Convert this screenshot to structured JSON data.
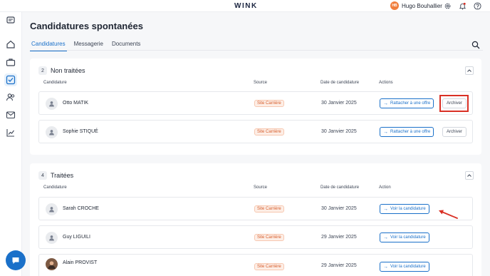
{
  "app": {
    "logo": "WINK"
  },
  "user": {
    "initials": "HB",
    "name": "Hugo Bouhallier"
  },
  "page": {
    "title": "Candidatures spontanées"
  },
  "tabs": [
    {
      "label": "Candidatures",
      "active": true
    },
    {
      "label": "Messagerie",
      "active": false
    },
    {
      "label": "Documents",
      "active": false
    }
  ],
  "sections": {
    "non_traitees": {
      "count": "2",
      "title": "Non traitées",
      "columns": {
        "candidate": "Candidature",
        "source": "Source",
        "date": "Date de candidature",
        "actions": "Actions"
      },
      "rows": [
        {
          "name": "Otto MATIK",
          "source": "Site Carrière",
          "date": "30 Janvier 2025",
          "primary_action": "Rattacher à une offre",
          "secondary_action": "Archiver"
        },
        {
          "name": "Sophie STIQUÉ",
          "source": "Site Carrière",
          "date": "30 Janvier 2025",
          "primary_action": "Rattacher à une offre",
          "secondary_action": "Archiver"
        }
      ]
    },
    "traitees": {
      "count": "4",
      "title": "Traitées",
      "columns": {
        "candidate": "Candidature",
        "source": "Source",
        "date": "Date de candidature",
        "action": "Action"
      },
      "rows": [
        {
          "name": "Sarah CROCHE",
          "source": "Site Carrière",
          "date": "30 Janvier 2025",
          "action": "Voir la candidature"
        },
        {
          "name": "Guy LIGUILI",
          "source": "Site Carrière",
          "date": "29 Janvier 2025",
          "action": "Voir la candidature"
        },
        {
          "name": "Alain PROVIST",
          "source": "Site Carrière",
          "date": "29 Janvier 2025",
          "action": "Voir la candidature"
        }
      ]
    }
  },
  "icons": {
    "top": [
      "gear-icon",
      "bell-icon",
      "help-icon"
    ],
    "sidebar": [
      "company-icon",
      "home-icon",
      "briefcase-icon",
      "applications-icon",
      "users-icon",
      "mail-icon",
      "chart-icon"
    ],
    "other": [
      "search-icon",
      "chevron-up-icon",
      "arrow-right-icon",
      "chat-icon"
    ]
  },
  "colors": {
    "accent": "#1a70c9",
    "source_badge": "#d65c2b",
    "annotation": "#d93025",
    "avatar": "#f07e3d"
  }
}
